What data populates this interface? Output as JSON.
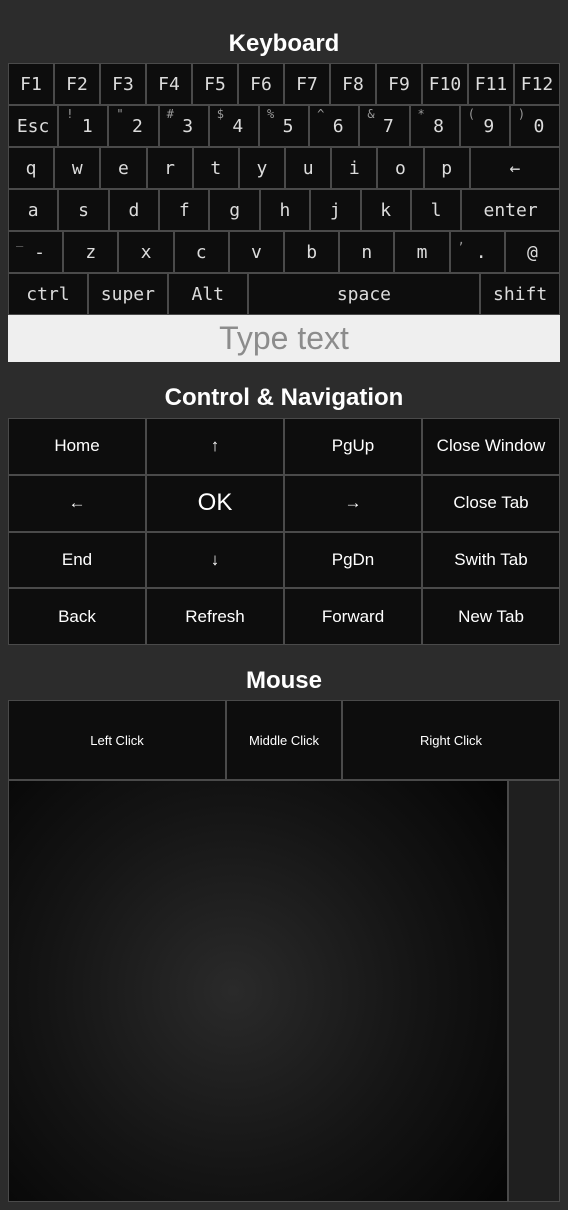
{
  "keyboard": {
    "title": "Keyboard",
    "rows": [
      [
        {
          "k": "F1"
        },
        {
          "k": "F2"
        },
        {
          "k": "F3"
        },
        {
          "k": "F4"
        },
        {
          "k": "F5"
        },
        {
          "k": "F6"
        },
        {
          "k": "F7"
        },
        {
          "k": "F8"
        },
        {
          "k": "F9"
        },
        {
          "k": "F10"
        },
        {
          "k": "F11"
        },
        {
          "k": "F12"
        }
      ],
      [
        {
          "k": "Esc"
        },
        {
          "k": "1",
          "s": "!"
        },
        {
          "k": "2",
          "s": "\""
        },
        {
          "k": "3",
          "s": "#"
        },
        {
          "k": "4",
          "s": "$"
        },
        {
          "k": "5",
          "s": "%"
        },
        {
          "k": "6",
          "s": "^"
        },
        {
          "k": "7",
          "s": "&"
        },
        {
          "k": "8",
          "s": "*"
        },
        {
          "k": "9",
          "s": "("
        },
        {
          "k": "0",
          "s": ")"
        }
      ],
      [
        {
          "k": "q"
        },
        {
          "k": "w"
        },
        {
          "k": "e"
        },
        {
          "k": "r"
        },
        {
          "k": "t"
        },
        {
          "k": "y"
        },
        {
          "k": "u"
        },
        {
          "k": "i"
        },
        {
          "k": "o"
        },
        {
          "k": "p"
        },
        {
          "k": "←",
          "w": 2
        }
      ],
      [
        {
          "k": "a"
        },
        {
          "k": "s"
        },
        {
          "k": "d"
        },
        {
          "k": "f"
        },
        {
          "k": "g"
        },
        {
          "k": "h"
        },
        {
          "k": "j"
        },
        {
          "k": "k"
        },
        {
          "k": "l"
        },
        {
          "k": "enter",
          "w": 2
        }
      ],
      [
        {
          "k": "-",
          "s": "_"
        },
        {
          "k": "z"
        },
        {
          "k": "x"
        },
        {
          "k": "c"
        },
        {
          "k": "v"
        },
        {
          "k": "b"
        },
        {
          "k": "n"
        },
        {
          "k": "m"
        },
        {
          "k": ".",
          "s": ","
        },
        {
          "k": "@"
        }
      ],
      [
        {
          "k": "ctrl",
          "w": 1.42
        },
        {
          "k": "super",
          "w": 1.42
        },
        {
          "k": "Alt",
          "w": 1.42
        },
        {
          "k": "space",
          "w": 4.2
        },
        {
          "k": "shift",
          "w": 1.42
        }
      ]
    ]
  },
  "input": {
    "placeholder": "Type text"
  },
  "control": {
    "title": "Control & Navigation",
    "buttons": [
      "Home",
      "↑",
      "PgUp",
      "Close Window",
      "←",
      "OK",
      "→",
      "Close Tab",
      "End",
      "↓",
      "PgDn",
      "Swith Tab",
      "Back",
      "Refresh",
      "Forward",
      "New Tab"
    ]
  },
  "mouse": {
    "title": "Mouse",
    "left": "Left Click",
    "middle": "Middle Click",
    "right": "Right Click"
  }
}
